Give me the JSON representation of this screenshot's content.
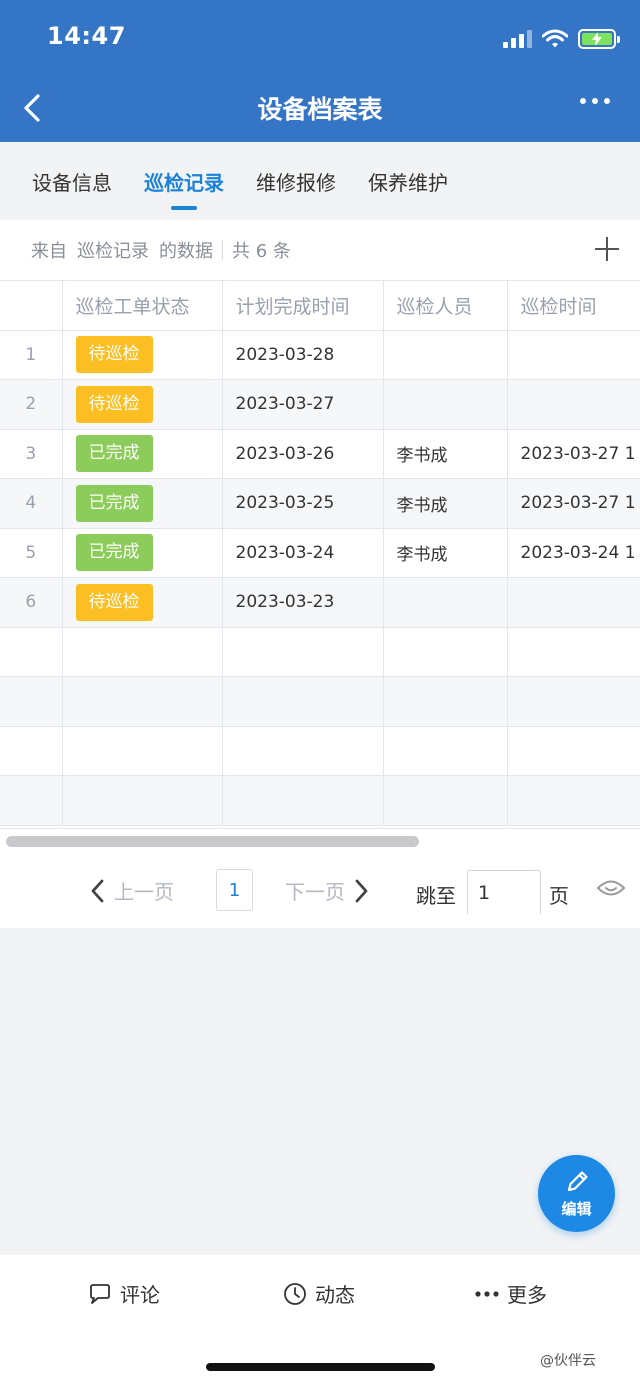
{
  "status": {
    "time": "14:47"
  },
  "header": {
    "title": "设备档案表"
  },
  "tabs": [
    {
      "label": "设备信息",
      "active": false
    },
    {
      "label": "巡检记录",
      "active": true
    },
    {
      "label": "维修报修",
      "active": false
    },
    {
      "label": "保养维护",
      "active": false
    }
  ],
  "source": {
    "prefix": "来自",
    "name": "巡检记录",
    "suffix": "的数据",
    "count": "共 6 条"
  },
  "table": {
    "headers": [
      "",
      "巡检工单状态",
      "计划完成时间",
      "巡检人员",
      "巡检时间"
    ],
    "rows": [
      {
        "num": "1",
        "status": "待巡检",
        "status_type": "pending",
        "plan": "2023-03-28",
        "person": "",
        "time": ""
      },
      {
        "num": "2",
        "status": "待巡检",
        "status_type": "pending",
        "plan": "2023-03-27",
        "person": "",
        "time": ""
      },
      {
        "num": "3",
        "status": "已完成",
        "status_type": "done",
        "plan": "2023-03-26",
        "person": "李书成",
        "time": "2023-03-27 1"
      },
      {
        "num": "4",
        "status": "已完成",
        "status_type": "done",
        "plan": "2023-03-25",
        "person": "李书成",
        "time": "2023-03-27 1"
      },
      {
        "num": "5",
        "status": "已完成",
        "status_type": "done",
        "plan": "2023-03-24",
        "person": "李书成",
        "time": "2023-03-24 1"
      },
      {
        "num": "6",
        "status": "待巡检",
        "status_type": "pending",
        "plan": "2023-03-23",
        "person": "",
        "time": ""
      }
    ]
  },
  "pager": {
    "prev": "上一页",
    "current": "1",
    "next": "下一页",
    "jump_label": "跳至",
    "jump_value": "1",
    "unit": "页"
  },
  "fab": {
    "label": "编辑"
  },
  "bottom": {
    "comment": "评论",
    "activity": "动态",
    "more": "更多"
  },
  "watermark": "@伙伴云",
  "colors": {
    "header": "#3575c6",
    "accent": "#1b82d8",
    "pending": "#fbbf24",
    "done": "#8ccc5a",
    "fab": "#1e88e5"
  }
}
